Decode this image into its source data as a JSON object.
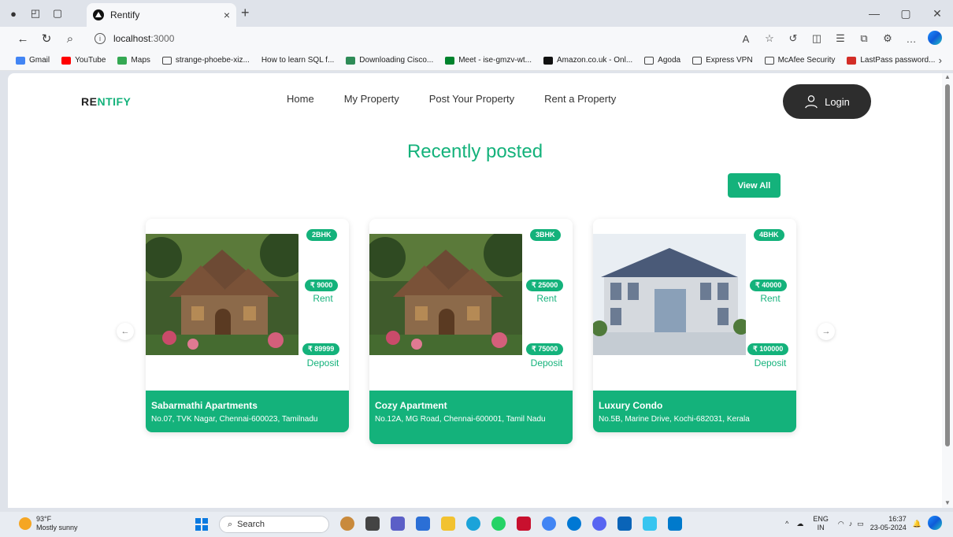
{
  "browser": {
    "tab_title": "Rentify",
    "tab_close": "×",
    "new_tab": "+",
    "url_host": "localhost",
    "url_port": ":3000",
    "bookmarks": [
      {
        "label": "Gmail",
        "color": "#4285f4"
      },
      {
        "label": "YouTube",
        "color": "#ff0000"
      },
      {
        "label": "Maps",
        "color": "#34a853"
      },
      {
        "label": "strange-phoebe-xiz...",
        "color": "#ffffff"
      },
      {
        "label": "How to learn SQL f...",
        "color": "#dddddd"
      },
      {
        "label": "Downloading Cisco...",
        "color": "#2e8b57"
      },
      {
        "label": "Meet - ise-gmzv-wt...",
        "color": "#00832d"
      },
      {
        "label": "Amazon.co.uk - Onl...",
        "color": "#111111"
      },
      {
        "label": "Agoda",
        "color": "#ffffff"
      },
      {
        "label": "Express VPN",
        "color": "#ffffff"
      },
      {
        "label": "McAfee Security",
        "color": "#ffffff"
      },
      {
        "label": "LastPass password...",
        "color": "#d32d27"
      }
    ]
  },
  "site": {
    "brand_part1": "RE",
    "brand_part2": "NTIFY",
    "accent": "#14b27b",
    "nav": [
      "Home",
      "My Property",
      "Post Your Property",
      "Rent a Property"
    ],
    "login_label": "Login",
    "section_title": "Recently posted",
    "view_all_label": "View All",
    "listings": [
      {
        "type": "2BHK",
        "rent": "₹ 9000",
        "rent_label": "Rent",
        "deposit": "₹ 89999",
        "deposit_label": "Deposit",
        "name": "Sabarmathi Apartments",
        "address": "No.07, TVK Nagar, Chennai-600023, Tamilnadu",
        "photo": "cottage"
      },
      {
        "type": "3BHK",
        "rent": "₹ 25000",
        "rent_label": "Rent",
        "deposit": "₹ 75000",
        "deposit_label": "Deposit",
        "name": "Cozy Apartment",
        "address": "No.12A, MG Road, Chennai-600001, Tamil Nadu",
        "photo": "cottage"
      },
      {
        "type": "4BHK",
        "rent": "₹ 40000",
        "rent_label": "Rent",
        "deposit": "₹ 100000",
        "deposit_label": "Deposit",
        "name": "Luxury Condo",
        "address": "No.5B, Marine Drive, Kochi-682031, Kerala",
        "photo": "mansion"
      }
    ]
  },
  "taskbar": {
    "temperature": "93°F",
    "weather": "Mostly sunny",
    "search_placeholder": "Search",
    "lang_top": "ENG",
    "lang_bottom": "IN",
    "time": "16:37",
    "date": "23-05-2024"
  }
}
